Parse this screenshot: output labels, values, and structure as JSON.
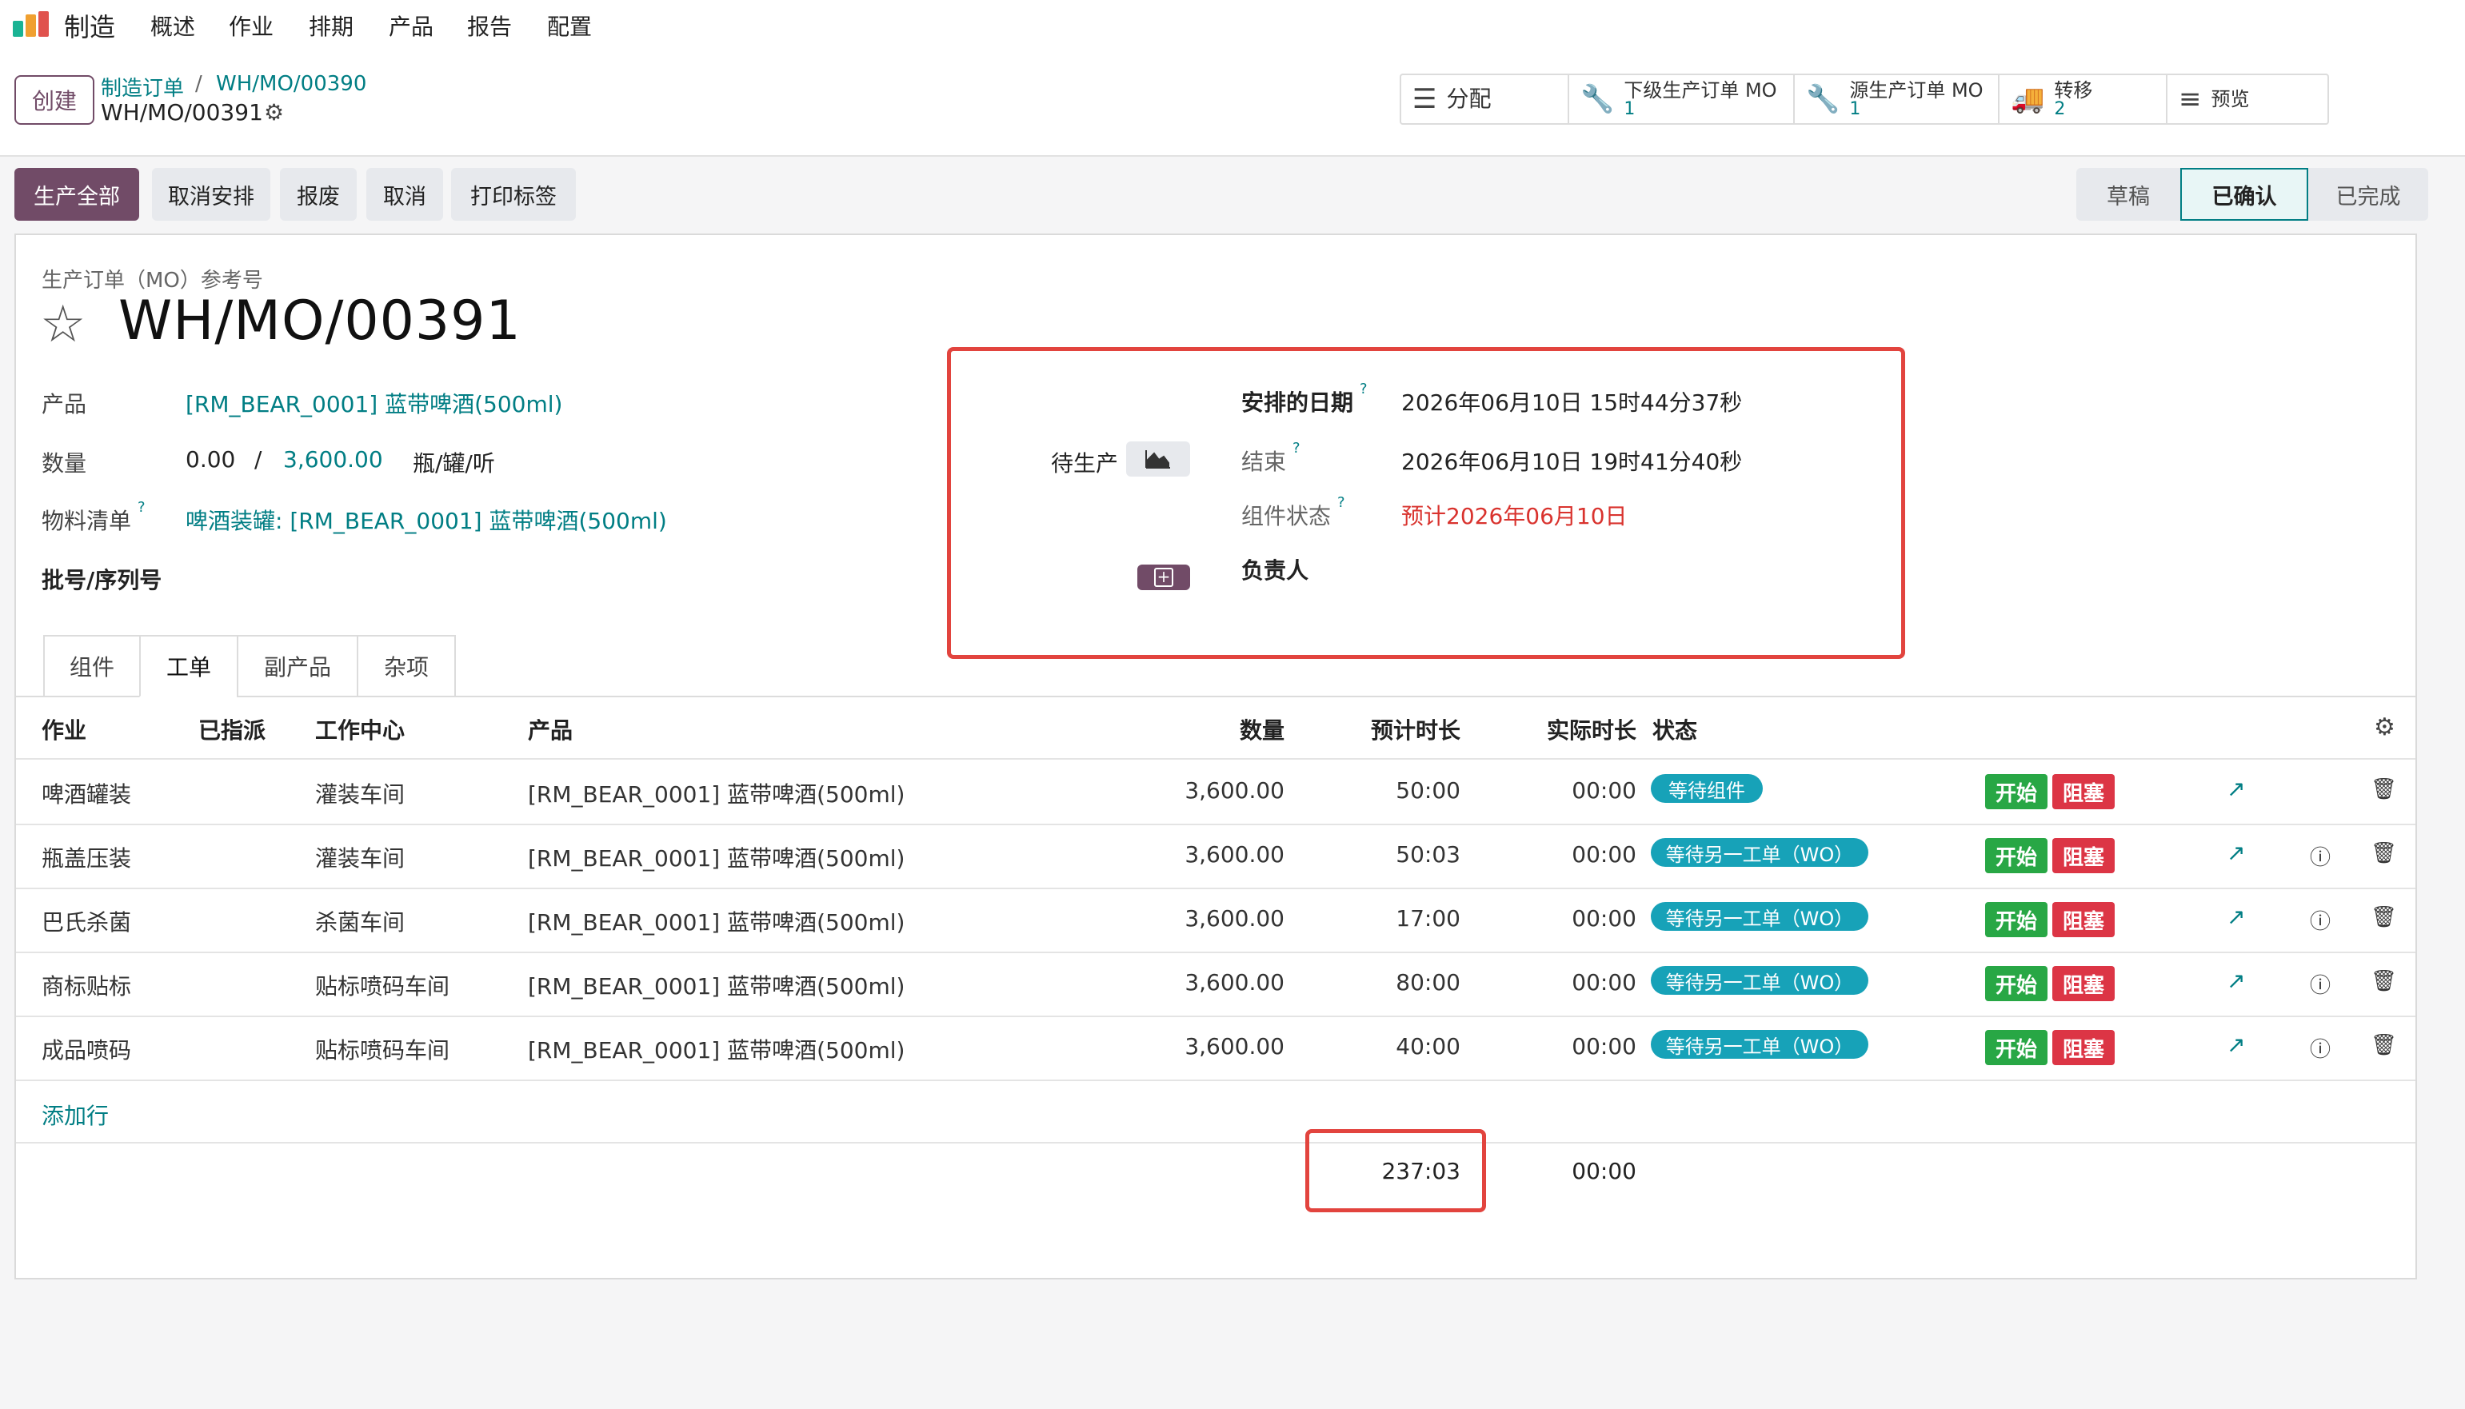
{
  "nav": {
    "brand": "制造",
    "items": [
      "概述",
      "作业",
      "排期",
      "产品",
      "报告",
      "配置"
    ]
  },
  "control_panel": {
    "create_label": "创建",
    "breadcrumb": [
      "制造订单",
      "WH/MO/00390"
    ],
    "current": "WH/MO/00391",
    "smart_buttons": [
      {
        "label": "分配",
        "count": ""
      },
      {
        "label": "下级生产订单 MO",
        "count": "1"
      },
      {
        "label": "源生产订单 MO",
        "count": "1"
      },
      {
        "label": "转移",
        "count": "2"
      },
      {
        "label": "预览",
        "count": ""
      }
    ]
  },
  "actions": [
    "生产全部",
    "取消安排",
    "报废",
    "取消",
    "打印标签"
  ],
  "status": [
    "草稿",
    "已确认",
    "已完成"
  ],
  "form": {
    "ref_label": "生产订单（MO）参考号",
    "title": "WH/MO/00391",
    "product_label": "产品",
    "product_value": "[RM_BEAR_0001] 蓝带啤酒(500ml)",
    "qty_label": "数量",
    "qty_produced": "0.00",
    "qty_sep": "/",
    "qty_total": "3,600.00",
    "qty_unit": "瓶/罐/听",
    "bom_label": "物料清单",
    "bom_value": "啤酒装罐: [RM_BEAR_0001] 蓝带啤酒(500ml)",
    "lot_label": "批号/序列号",
    "pending_label": "待生产",
    "scheduled_label": "安排的日期",
    "scheduled_value": "2026年06月10日 15时44分37秒",
    "end_label": "结束",
    "end_value": "2026年06月10日 19时41分40秒",
    "component_status_label": "组件状态",
    "component_status_value": "预计2026年06月10日",
    "responsible_label": "负责人",
    "help_mark": "?"
  },
  "tabs": [
    "组件",
    "工单",
    "副产品",
    "杂项"
  ],
  "table": {
    "headers": [
      "作业",
      "已指派",
      "工作中心",
      "产品",
      "数量",
      "预计时长",
      "实际时长",
      "状态"
    ],
    "rows": [
      {
        "op": "啤酒罐装",
        "wc": "灌装车间",
        "product": "[RM_BEAR_0001] 蓝带啤酒(500ml)",
        "qty": "3,600.00",
        "expected": "50:00",
        "actual": "00:00",
        "status": "等待组件"
      },
      {
        "op": "瓶盖压装",
        "wc": "灌装车间",
        "product": "[RM_BEAR_0001] 蓝带啤酒(500ml)",
        "qty": "3,600.00",
        "expected": "50:03",
        "actual": "00:00",
        "status": "等待另一工单（WO）"
      },
      {
        "op": "巴氏杀菌",
        "wc": "杀菌车间",
        "product": "[RM_BEAR_0001] 蓝带啤酒(500ml)",
        "qty": "3,600.00",
        "expected": "17:00",
        "actual": "00:00",
        "status": "等待另一工单（WO）"
      },
      {
        "op": "商标贴标",
        "wc": "贴标喷码车间",
        "product": "[RM_BEAR_0001] 蓝带啤酒(500ml)",
        "qty": "3,600.00",
        "expected": "80:00",
        "actual": "00:00",
        "status": "等待另一工单（WO）"
      },
      {
        "op": "成品喷码",
        "wc": "贴标喷码车间",
        "product": "[RM_BEAR_0001] 蓝带啤酒(500ml)",
        "qty": "3,600.00",
        "expected": "40:00",
        "actual": "00:00",
        "status": "等待另一工单（WO）"
      }
    ],
    "start_label": "开始",
    "block_label": "阻塞",
    "add_line": "添加行",
    "total_expected": "237:03",
    "total_actual": "00:00"
  },
  "colors": {
    "primary": "#714b67",
    "link": "#017e84",
    "badge": "#17a2b8",
    "start": "#28a745",
    "block": "#dc3545",
    "highlight": "#e2443e"
  }
}
